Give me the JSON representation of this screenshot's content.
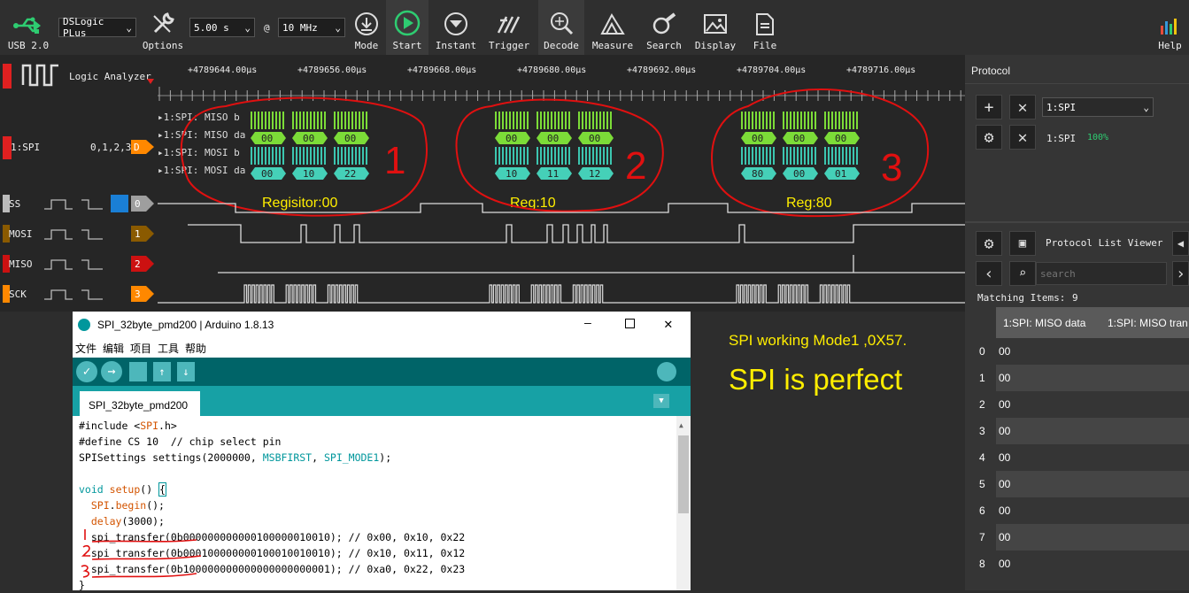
{
  "toolbar": {
    "usb_label": "USB 2.0",
    "device": "DSLogic PLus",
    "options": "Options",
    "duration": "5.00 s",
    "at": "@",
    "rate": "10 MHz",
    "mode": "Mode",
    "start": "Start",
    "instant": "Instant",
    "trigger": "Trigger",
    "decode": "Decode",
    "measure": "Measure",
    "search": "Search",
    "display": "Display",
    "file": "File",
    "help": "Help"
  },
  "wave": {
    "title": "Logic Analyzer",
    "ticks": [
      "+4789644.00μs",
      "+4789656.00μs",
      "+4789668.00μs",
      "+4789680.00μs",
      "+4789692.00μs",
      "+4789704.00μs",
      "+4789716.00μs"
    ],
    "decoder_label": "1:SPI",
    "decoder_channels": "0,1,2,3",
    "decoder_badge": "D",
    "decoder_rows": [
      "1:SPI: MISO b",
      "1:SPI: MISO da",
      "1:SPI: MOSI b",
      "1:SPI: MOSI da"
    ],
    "frames": [
      {
        "miso": [
          "00",
          "00",
          "00"
        ],
        "mosi": [
          "00",
          "10",
          "22"
        ],
        "note": "Regisitor:00",
        "num": "1"
      },
      {
        "miso": [
          "00",
          "00",
          "00"
        ],
        "mosi": [
          "10",
          "11",
          "12"
        ],
        "note": "Reg:10",
        "num": "2"
      },
      {
        "miso": [
          "00",
          "00",
          "00"
        ],
        "mosi": [
          "80",
          "00",
          "01"
        ],
        "note": "Reg:80",
        "num": "3"
      }
    ],
    "channels": [
      {
        "name": "SS",
        "index": "0",
        "color": "#9e9e9e"
      },
      {
        "name": "MOSI",
        "index": "1",
        "color": "#8a5a00"
      },
      {
        "name": "MISO",
        "index": "2",
        "color": "#cc1111"
      },
      {
        "name": "SCK",
        "index": "3",
        "color": "#ff8800"
      }
    ]
  },
  "protocol": {
    "title": "Protocol",
    "select": "1:SPI",
    "decoder": "1:SPI",
    "progress": "100%",
    "viewer": "Protocol List Viewer",
    "search_placeholder": "search",
    "matching_label": "Matching Items:",
    "matching_count": "9",
    "col1": "1:SPI: MISO data",
    "col2": "1:SPI: MISO tran",
    "rows": [
      {
        "n": "0",
        "v": "00"
      },
      {
        "n": "1",
        "v": "00"
      },
      {
        "n": "2",
        "v": "00"
      },
      {
        "n": "3",
        "v": "00"
      },
      {
        "n": "4",
        "v": "00"
      },
      {
        "n": "5",
        "v": "00"
      },
      {
        "n": "6",
        "v": "00"
      },
      {
        "n": "7",
        "v": "00"
      },
      {
        "n": "8",
        "v": "00"
      }
    ]
  },
  "ide": {
    "title": "SPI_32byte_pmd200 | Arduino 1.8.13",
    "menu": [
      "文件",
      "编辑",
      "项目",
      "工具",
      "帮助"
    ],
    "tab": "SPI_32byte_pmd200"
  },
  "notes": {
    "mode": "SPI working Mode1 ,0X57.",
    "perfect": "SPI is perfect"
  }
}
